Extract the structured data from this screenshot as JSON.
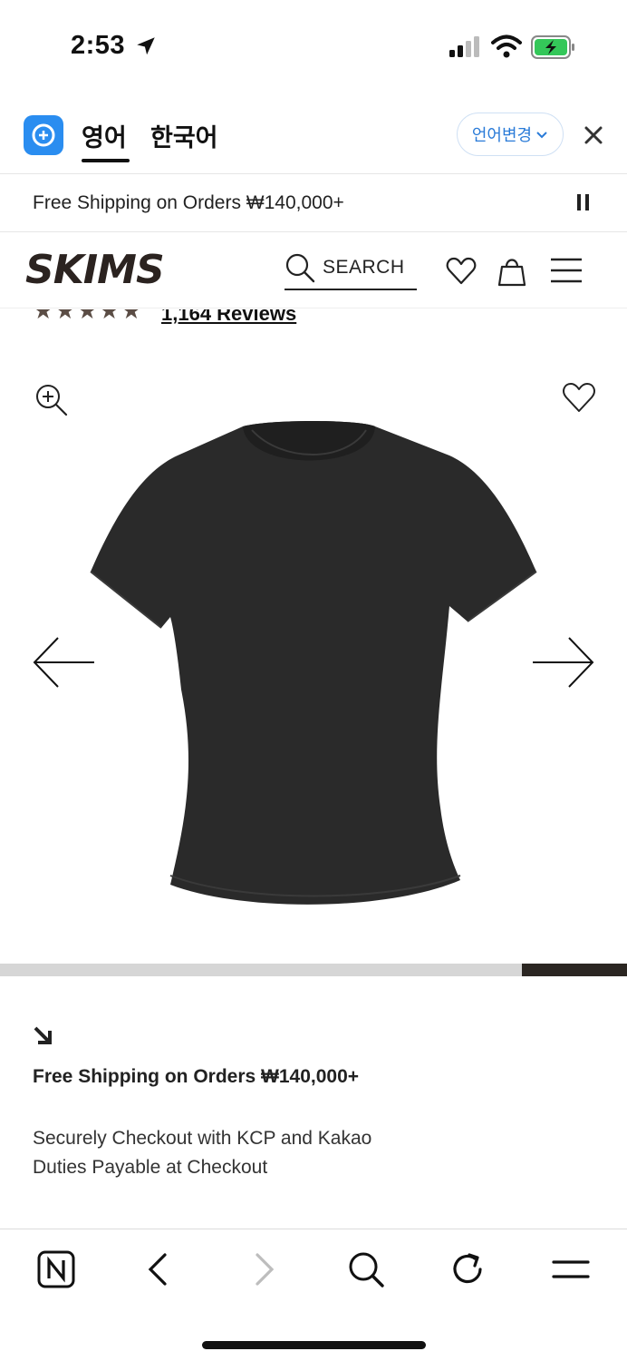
{
  "status_bar": {
    "time": "2:53",
    "icons": [
      "location-arrow-icon",
      "cellular-signal-icon",
      "wifi-icon",
      "battery-charging-icon"
    ]
  },
  "translate_bar": {
    "tabs": [
      "영어",
      "한국어"
    ],
    "active_tab": "영어",
    "change_language_label": "언어변경",
    "icons": [
      "translate-app-icon",
      "chevron-down-icon",
      "close-icon"
    ]
  },
  "announcement": {
    "text": "Free Shipping on Orders ₩140,000+",
    "icons": [
      "pause-icon"
    ]
  },
  "header": {
    "logo": "SKIMS",
    "search_label": "SEARCH",
    "icons": [
      "search-icon",
      "heart-icon",
      "bag-icon",
      "menu-icon"
    ]
  },
  "rating": {
    "stars": "★★★★★",
    "value": 4.5,
    "reviews_label": "1,164 Reviews"
  },
  "product_gallery": {
    "image": "black short sleeve t-shirt",
    "icons": [
      "zoom-in-icon",
      "wishlist-heart-icon",
      "arrow-left-icon",
      "arrow-right-icon"
    ],
    "progress_start": 0.833,
    "progress_end": 1.0
  },
  "info": {
    "title": "Free Shipping on Orders ₩140,000+",
    "lines": [
      "Securely Checkout with KCP and Kakao",
      "Duties Payable at Checkout"
    ],
    "icons": [
      "arrow-down-right-icon"
    ]
  },
  "browser_toolbar": {
    "icons": [
      "naver-home-icon",
      "back-icon",
      "forward-icon",
      "search-icon",
      "refresh-icon",
      "menu-icon"
    ]
  },
  "colors": {
    "accent_blue": "#2a8df0",
    "link_blue": "#2a7bd8",
    "battery_green": "#34c759",
    "progress_fill": "#2b2622",
    "progress_track": "#d6d6d6",
    "star": "#5b4d45"
  }
}
